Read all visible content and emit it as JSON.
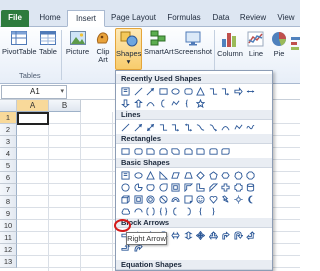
{
  "tabs": [
    {
      "label": "File"
    },
    {
      "label": "Home"
    },
    {
      "label": "Insert"
    },
    {
      "label": "Page Layout"
    },
    {
      "label": "Formulas"
    },
    {
      "label": "Data"
    },
    {
      "label": "Review"
    },
    {
      "label": "View"
    }
  ],
  "ribbon": {
    "pivottable": "PivotTable",
    "table": "Table",
    "picture": "Picture",
    "clip_art_line1": "Clip",
    "clip_art_line2": "Art",
    "shapes": "Shapes",
    "smartart": "SmartArt",
    "screenshot": "Screenshot",
    "column": "Column",
    "line": "Line",
    "pie": "Pie",
    "group_tables": "Tables"
  },
  "formula_bar": {
    "name_box": "A1"
  },
  "grid": {
    "columns": [
      "A",
      "B"
    ],
    "rows": [
      "1",
      "2",
      "3",
      "4",
      "5",
      "6",
      "7",
      "8",
      "9",
      "10",
      "11",
      "12",
      "13"
    ]
  },
  "shapes_menu": {
    "sections": {
      "recent": "Recently Used Shapes",
      "lines": "Lines",
      "rectangles": "Rectangles",
      "basic": "Basic Shapes",
      "block_arrows": "Block Arrows",
      "equation": "Equation Shapes"
    },
    "tooltip": "Right Arrow"
  },
  "colors": {
    "file_tab": "#2d7b3d",
    "ribbon_bg": "#e7eef8",
    "highlight_ring": "#d41a1a",
    "shape_stroke": "#2b5797",
    "selected_header": "#f8d99a"
  }
}
